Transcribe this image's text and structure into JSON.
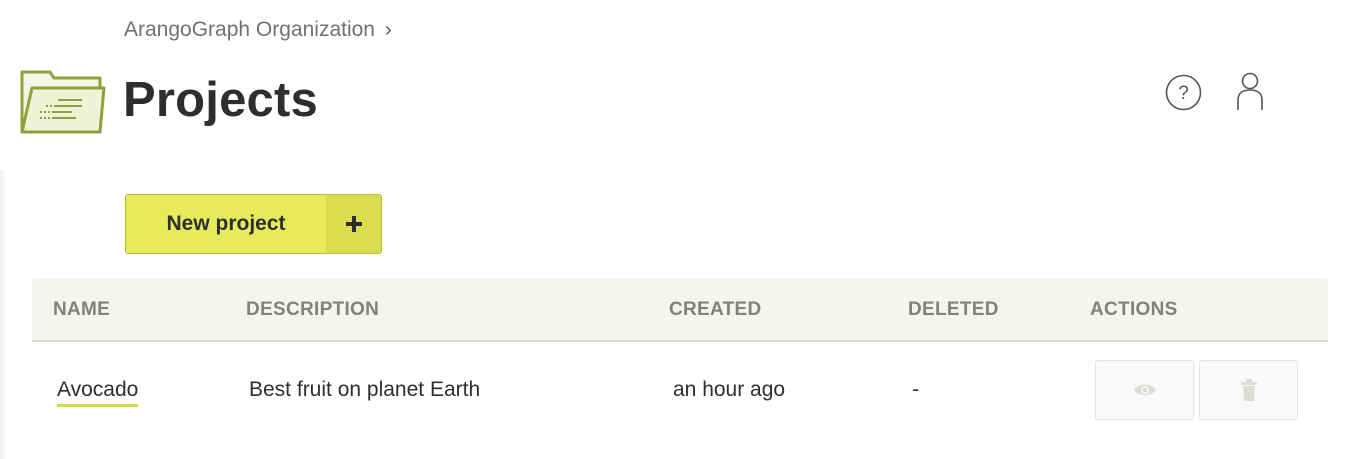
{
  "breadcrumb": {
    "parent": "ArangoGraph Organization",
    "separator": "›"
  },
  "page": {
    "title": "Projects"
  },
  "header_icons": {
    "help": "help-circle-icon",
    "user": "user-icon"
  },
  "actions": {
    "new_project_label": "New project",
    "new_project_icon": "plus-icon"
  },
  "colors": {
    "accent": "#e8eb59",
    "accent_dark": "#dadd4f",
    "header_bg": "#f4f4f0",
    "folder_green": "#8fa13a"
  },
  "table": {
    "columns": [
      "NAME",
      "DESCRIPTION",
      "CREATED",
      "DELETED",
      "ACTIONS"
    ],
    "rows": [
      {
        "name": "Avocado",
        "description": "Best fruit on planet Earth",
        "created": "an hour ago",
        "deleted": "-",
        "actions": [
          "eye-icon",
          "trash-icon"
        ]
      }
    ]
  }
}
